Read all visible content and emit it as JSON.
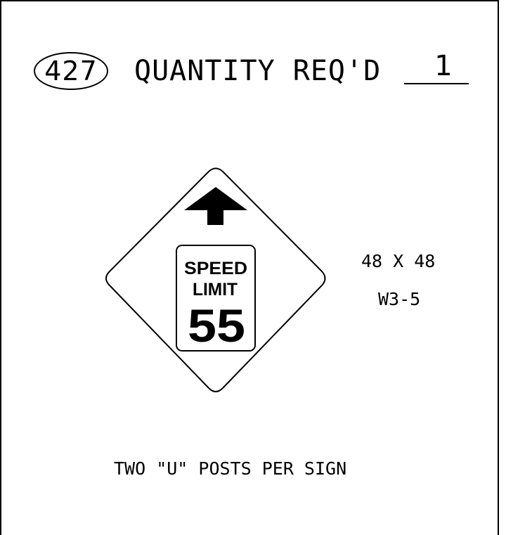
{
  "header": {
    "item_number": "427",
    "quantity_label": "QUANTITY REQ'D",
    "quantity_value": "1"
  },
  "sign": {
    "line1": "SPEED",
    "line2": "LIMIT",
    "speed": "55",
    "arrow_icon": "arrow-up-icon"
  },
  "sign_info": {
    "size": "48 X 48",
    "code": "W3-5"
  },
  "note": "TWO \"U\" POSTS PER SIGN"
}
